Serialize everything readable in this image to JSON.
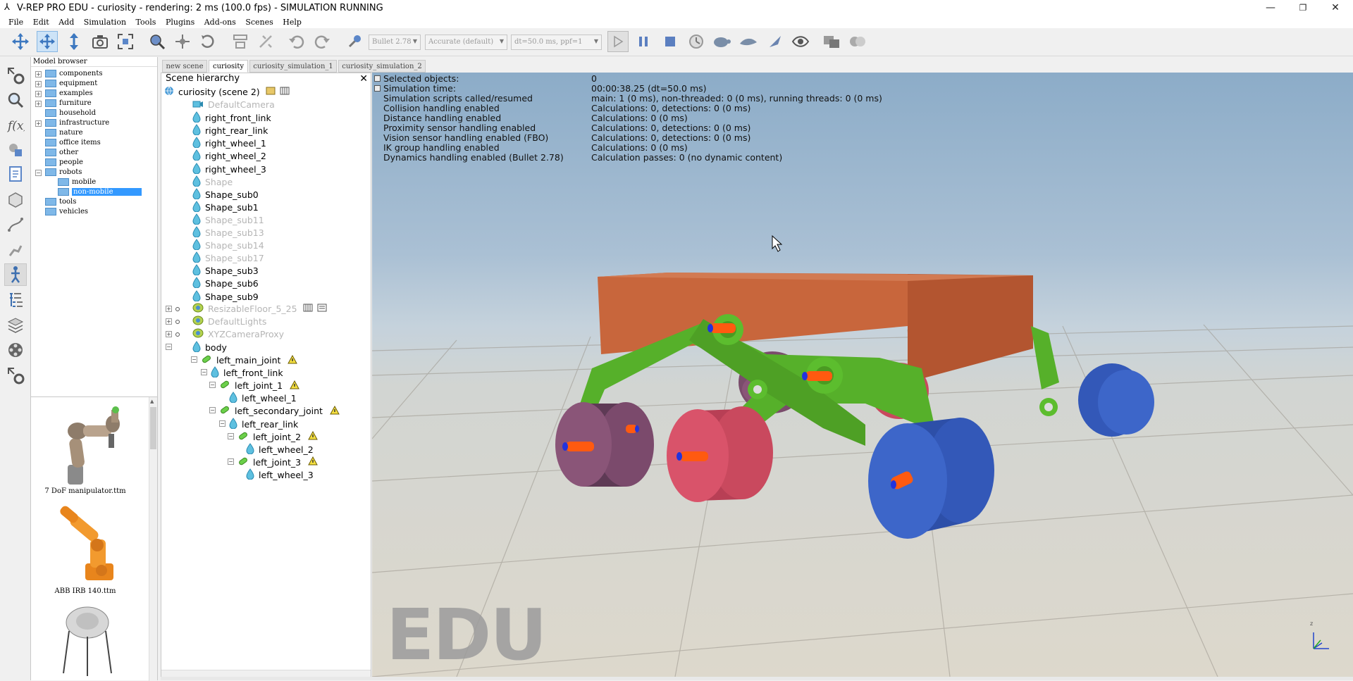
{
  "window": {
    "title": "V-REP PRO EDU - curiosity - rendering: 2 ms (100.0 fps) - SIMULATION RUNNING",
    "minimize": "—",
    "maximize": "❐",
    "close": "✕"
  },
  "menu": [
    "File",
    "Edit",
    "Add",
    "Simulation",
    "Tools",
    "Plugins",
    "Add-ons",
    "Scenes",
    "Help"
  ],
  "toolbar": {
    "engine": "Bullet 2.78",
    "accuracy": "Accurate (default)",
    "timestep": "dt=50.0 ms, ppf=1"
  },
  "model_browser": {
    "title": "Model browser",
    "folders": [
      {
        "label": "components",
        "expandable": true
      },
      {
        "label": "equipment",
        "expandable": true
      },
      {
        "label": "examples",
        "expandable": true
      },
      {
        "label": "furniture",
        "expandable": true
      },
      {
        "label": "household",
        "expandable": false
      },
      {
        "label": "infrastructure",
        "expandable": true
      },
      {
        "label": "nature",
        "expandable": false
      },
      {
        "label": "office items",
        "expandable": false
      },
      {
        "label": "other",
        "expandable": false
      },
      {
        "label": "people",
        "expandable": false
      },
      {
        "label": "robots",
        "expandable": true,
        "expanded": true
      },
      {
        "label": "mobile",
        "expandable": false,
        "child": true
      },
      {
        "label": "non-mobile",
        "expandable": false,
        "child": true,
        "selected": true
      },
      {
        "label": "tools",
        "expandable": false
      },
      {
        "label": "vehicles",
        "expandable": false
      }
    ],
    "thumbnails": [
      {
        "label": "7 DoF manipulator.ttm"
      },
      {
        "label": "ABB IRB 140.ttm"
      }
    ]
  },
  "scene_tabs": [
    "new scene",
    "curiosity",
    "curiosity_simulation_1",
    "curiosity_simulation_2"
  ],
  "hierarchy": {
    "title": "Scene hierarchy",
    "root": "curiosity (scene 2)",
    "items": [
      {
        "label": "DefaultCamera",
        "type": "camera",
        "gray": true
      },
      {
        "label": "right_front_link",
        "type": "shape"
      },
      {
        "label": "right_rear_link",
        "type": "shape"
      },
      {
        "label": "right_wheel_1",
        "type": "shape"
      },
      {
        "label": "right_wheel_2",
        "type": "shape"
      },
      {
        "label": "right_wheel_3",
        "type": "shape"
      },
      {
        "label": "Shape",
        "type": "shape",
        "gray": true
      },
      {
        "label": "Shape_sub0",
        "type": "shape"
      },
      {
        "label": "Shape_sub1",
        "type": "shape"
      },
      {
        "label": "Shape_sub11",
        "type": "shape",
        "gray": true
      },
      {
        "label": "Shape_sub13",
        "type": "shape",
        "gray": true
      },
      {
        "label": "Shape_sub14",
        "type": "shape",
        "gray": true
      },
      {
        "label": "Shape_sub17",
        "type": "shape",
        "gray": true
      },
      {
        "label": "Shape_sub3",
        "type": "shape"
      },
      {
        "label": "Shape_sub6",
        "type": "shape"
      },
      {
        "label": "Shape_sub9",
        "type": "shape"
      },
      {
        "label": "ResizableFloor_5_25",
        "type": "model",
        "gray": true
      },
      {
        "label": "DefaultLights",
        "type": "model",
        "gray": true
      },
      {
        "label": "XYZCameraProxy",
        "type": "model",
        "gray": true
      },
      {
        "label": "body",
        "type": "shape"
      },
      {
        "label": "left_main_joint",
        "type": "joint",
        "warn": true
      },
      {
        "label": "left_front_link",
        "type": "shape"
      },
      {
        "label": "left_joint_1",
        "type": "joint",
        "warn": true
      },
      {
        "label": "left_wheel_1",
        "type": "shape"
      },
      {
        "label": "left_secondary_joint",
        "type": "joint",
        "warn": true
      },
      {
        "label": "left_rear_link",
        "type": "shape"
      },
      {
        "label": "left_joint_2",
        "type": "joint",
        "warn": true
      },
      {
        "label": "left_wheel_2",
        "type": "shape"
      },
      {
        "label": "left_joint_3",
        "type": "joint",
        "warn": true
      },
      {
        "label": "left_wheel_3",
        "type": "shape"
      }
    ]
  },
  "viewport": {
    "info": [
      {
        "k": "Selected objects:",
        "v": "0"
      },
      {
        "k": "Simulation time:",
        "v": "00:00:38.25 (dt=50.0 ms)"
      },
      {
        "k": "Simulation scripts called/resumed",
        "v": "main: 1 (0 ms), non-threaded: 0 (0 ms), running threads: 0 (0 ms)"
      },
      {
        "k": "Collision handling enabled",
        "v": "Calculations: 0, detections: 0 (0 ms)"
      },
      {
        "k": "Distance handling enabled",
        "v": "Calculations: 0 (0 ms)"
      },
      {
        "k": "Proximity sensor handling enabled",
        "v": "Calculations: 0, detections: 0 (0 ms)"
      },
      {
        "k": "Vision sensor handling enabled (FBO)",
        "v": "Calculations: 0, detections: 0 (0 ms)"
      },
      {
        "k": "IK group handling enabled",
        "v": "Calculations: 0 (0 ms)"
      },
      {
        "k": "Dynamics handling enabled (Bullet 2.78)",
        "v": "Calculation passes: 0 (no dynamic content)"
      }
    ],
    "watermark": "EDU",
    "axis_label": "z"
  },
  "colors": {
    "body": "#c8663c",
    "links": "#5ab52c",
    "wheel_purple": "#8a5578",
    "wheel_pink": "#d9536a",
    "wheel_blue": "#3a66c8",
    "axle": "#ff5a10",
    "selection": "#3399ff"
  }
}
